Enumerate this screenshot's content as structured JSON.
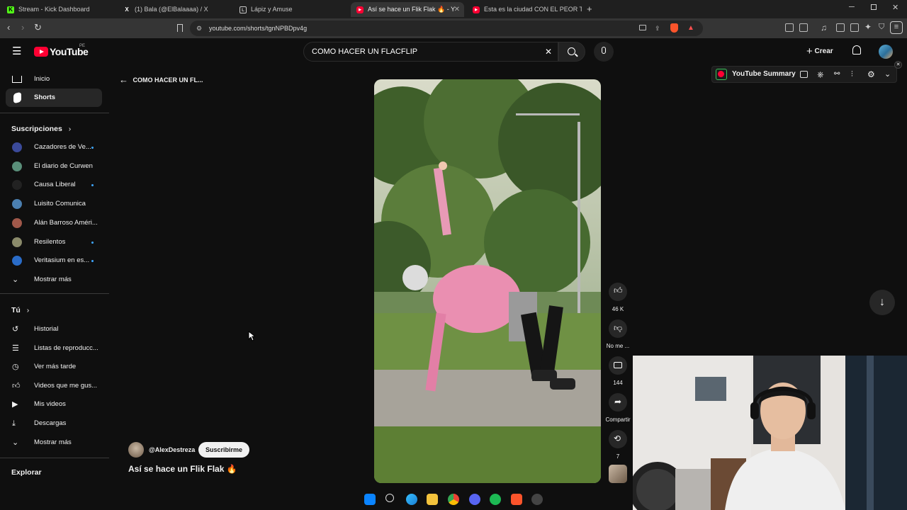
{
  "browser": {
    "tabs": [
      {
        "title": "Stream - Kick Dashboard",
        "icon": "K"
      },
      {
        "title": "(1) Bala (@ElBalaaaa) / X",
        "icon": "X"
      },
      {
        "title": "Lápiz y Amuse",
        "icon": "L"
      },
      {
        "title": "Así se hace un Flik Flak 🔥 - Y",
        "icon": "▶"
      },
      {
        "title": "Esta es la ciudad CON EL PEOR TRÁF",
        "icon": "▶"
      }
    ],
    "url": "youtube.com/shorts/tgnNPBDpv4g"
  },
  "header": {
    "logo_text": "YouTube",
    "region": "PE",
    "search_value": "COMO HACER UN FLACFLIP",
    "create_label": "Crear"
  },
  "sidebar": {
    "main": [
      {
        "label": "Inicio",
        "icon": "home-icon"
      },
      {
        "label": "Shorts",
        "icon": "shorts-icon"
      }
    ],
    "subs_title": "Suscripciones",
    "subscriptions": [
      {
        "label": "Cazadores de Ve...",
        "color": "#3b4a9a",
        "dot": true
      },
      {
        "label": "El diario de Curwen",
        "color": "#5a8f7a",
        "dot": false
      },
      {
        "label": "Causa Liberal",
        "color": "#222222",
        "dot": true
      },
      {
        "label": "Luisito Comunica",
        "color": "#4b7fb0",
        "dot": false
      },
      {
        "label": "Alán Barroso Améri...",
        "color": "#a0584a",
        "dot": false
      },
      {
        "label": "Resilentos",
        "color": "#8a8a6a",
        "dot": true
      },
      {
        "label": "Veritasium en es...",
        "color": "#2a6cc8",
        "dot": true
      }
    ],
    "subs_more": "Mostrar más",
    "you_title": "Tú",
    "you": [
      {
        "label": "Historial",
        "icon": "history-icon"
      },
      {
        "label": "Listas de reproducc...",
        "icon": "playlist-icon"
      },
      {
        "label": "Ver más tarde",
        "icon": "clock-icon"
      },
      {
        "label": "Videos que me gus...",
        "icon": "like-icon"
      },
      {
        "label": "Mis videos",
        "icon": "video-icon"
      },
      {
        "label": "Descargas",
        "icon": "download-icon"
      }
    ],
    "you_more": "Mostrar más",
    "explore_title": "Explorar"
  },
  "main": {
    "back_label": "COMO HACER UN FL...",
    "channel": "@AlexDestreza",
    "subscribe_label": "Suscribirme",
    "video_title": "Así se hace un Flik Flak 🔥",
    "likes": "46 K",
    "dislike_label": "No me ...",
    "comments": "144",
    "share_label": "Compartir",
    "remix_count": "7"
  },
  "extension": {
    "title": "YouTube Summary"
  },
  "colors": {
    "yt_red": "#ff0033",
    "accent_blue": "#3ea6ff",
    "bg": "#0f0f0f"
  }
}
